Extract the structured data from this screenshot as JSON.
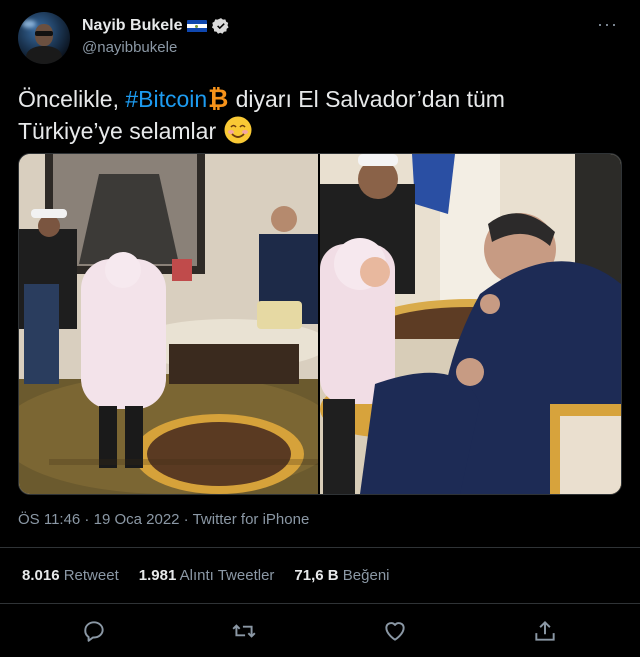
{
  "author": {
    "name": "Nayib Bukele",
    "handle": "@nayibbukele",
    "verified": true,
    "flag": "El Salvador flag"
  },
  "more_label": "···",
  "tweet": {
    "text_part1": "Öncelikle, ",
    "hashtag": "#Bitcoin",
    "text_part2": " diyarı El Salvador’dan tüm",
    "text_line2": "Türkiye’ye selamlar ",
    "emoji": [
      "bitcoin",
      "smiling-face"
    ]
  },
  "meta": {
    "time": "ÖS 11:46",
    "date": "19 Oca 2022",
    "source": "Twitter for iPhone",
    "separator": " · "
  },
  "stats": [
    {
      "value": "8.016",
      "label": "Retweet"
    },
    {
      "value": "1.981",
      "label": "Alıntı Tweetler"
    },
    {
      "value": "71,6 B",
      "label": "Beğeni"
    }
  ],
  "actions": [
    "reply-icon",
    "retweet-icon",
    "like-icon",
    "share-icon"
  ],
  "colors": {
    "background": "#000000",
    "text": "#e7e9ea",
    "secondary": "#8b98a5",
    "link": "#1d9bf0",
    "border": "#2f3336",
    "bitcoin": "#f7931a"
  }
}
